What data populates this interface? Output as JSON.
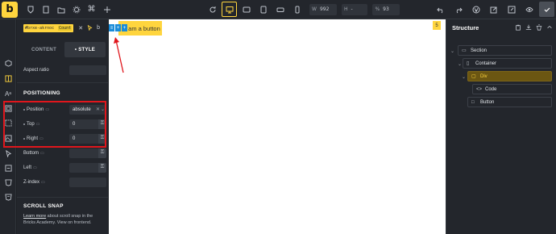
{
  "topbar": {
    "logo": "b",
    "left_icons": [
      "bricks-icon",
      "page-icon",
      "folder-icon",
      "gear-icon",
      "command-icon",
      "plus-icon"
    ],
    "center_icons": [
      "refresh-icon",
      "desktop-icon",
      "tablet-icon",
      "tablet-portrait-icon",
      "mobile-landscape-icon",
      "mobile-icon"
    ],
    "width_label": "W",
    "width_value": "992",
    "height_label": "H",
    "height_value": "-",
    "scale_label": "%",
    "scale_value": "93",
    "right_icons": [
      "undo-icon",
      "redo-icon",
      "wordpress-icon",
      "edit-icon",
      "external-link-icon",
      "eye-icon",
      "save-icon"
    ]
  },
  "element": {
    "id_label": "#brxe-akrnoc",
    "class_label": "Count",
    "action_x": "✕",
    "action_b": "b"
  },
  "tabs": {
    "content": "CONTENT",
    "style": "• STYLE"
  },
  "aspect_ratio": {
    "label": "Aspect ratio"
  },
  "positioning": {
    "heading": "POSITIONING",
    "position": {
      "label": "Position",
      "value": "absolute"
    },
    "top": {
      "label": "Top",
      "value": "0"
    },
    "right": {
      "label": "Right",
      "value": "0"
    },
    "bottom": {
      "label": "Bottom"
    },
    "left": {
      "label": "Left"
    },
    "z_index": {
      "label": "Z-index"
    }
  },
  "scroll_snap": {
    "heading": "SCROLL SNAP",
    "help_link": "Learn more",
    "help_text": " about scroll snap in the Bricks Academy. View on frontend."
  },
  "canvas": {
    "button_text": "I am a button",
    "count_badge": "5"
  },
  "structure": {
    "title": "Structure",
    "items": [
      {
        "label": "Section"
      },
      {
        "label": "Container"
      },
      {
        "label": "Div"
      },
      {
        "label": "Code"
      },
      {
        "label": "Button"
      }
    ]
  },
  "colors": {
    "accent": "#ffd53e",
    "highlight": "#e0161c",
    "selection": "#1a8cd8"
  }
}
